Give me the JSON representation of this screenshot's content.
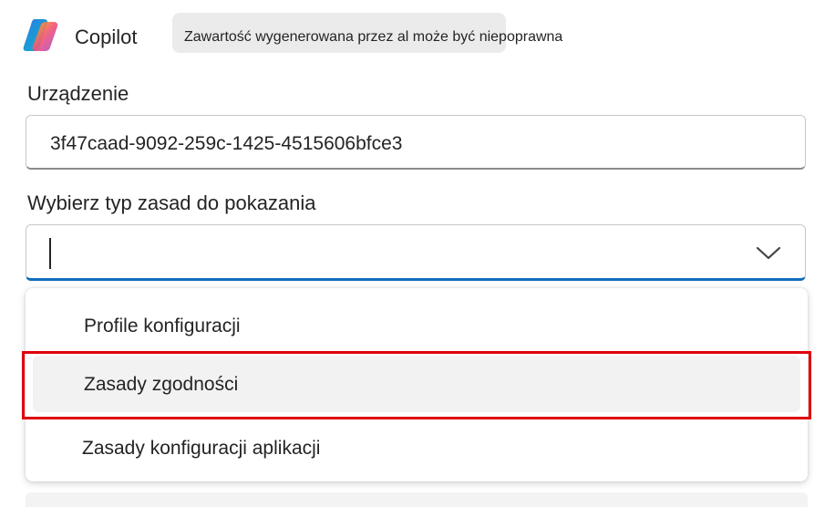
{
  "app": {
    "name": "Copilot"
  },
  "ai_notice": "Zawartość wygenerowana przez al może być niepoprawna",
  "device": {
    "label": "Urządzenie",
    "value": "3f47caad-9092-259c-1425-4515606bfce3"
  },
  "policy_select": {
    "label": "Wybierz typ zasad do pokazania",
    "value": "",
    "options": [
      {
        "label": "Profile konfiguracji"
      },
      {
        "label": "Zasady zgodności",
        "hovered": true
      },
      {
        "label": "Zasady konfiguracji aplikacji"
      }
    ]
  },
  "colors": {
    "accent": "#0f6cbd",
    "callout": "#e0000b",
    "hover": "#f2f2f2"
  },
  "icons": {
    "logo": "copilot-logo-icon",
    "chevron": "chevron-down-icon"
  }
}
